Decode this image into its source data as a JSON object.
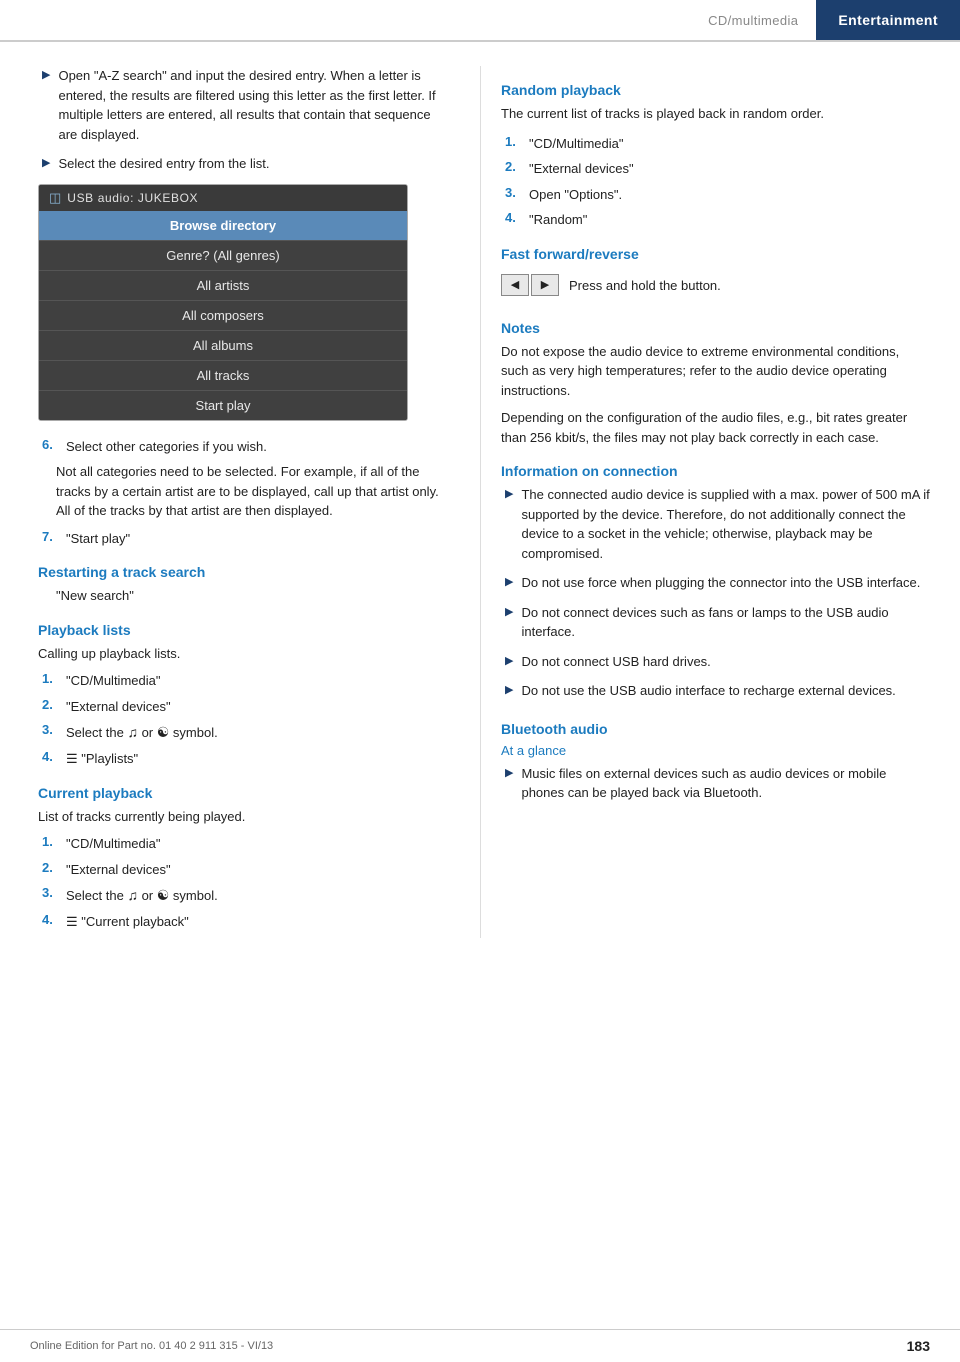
{
  "header": {
    "cd_label": "CD/multimedia",
    "entertainment_label": "Entertainment"
  },
  "left_col": {
    "bullet1": "Open \"A-Z search\" and input the desired entry. When a letter is entered, the results are filtered using this letter as the first letter. If multiple letters are entered, all results that contain that sequence are displayed.",
    "bullet2": "Select the desired entry from the list.",
    "usb_box": {
      "header_icon": "⊞",
      "header_title": "USB audio: JUKEBOX",
      "menu_items": [
        {
          "label": "Browse directory",
          "highlighted": true
        },
        {
          "label": "Genre? (All genres)",
          "highlighted": false
        },
        {
          "label": "All artists",
          "highlighted": false
        },
        {
          "label": "All composers",
          "highlighted": false
        },
        {
          "label": "All albums",
          "highlighted": false
        },
        {
          "label": "All tracks",
          "highlighted": false
        },
        {
          "label": "Start play",
          "highlighted": false
        }
      ]
    },
    "step6_label": "6.",
    "step6_text": "Select other categories if you wish.",
    "step6_detail": "Not all categories need to be selected. For example, if all of the tracks by a certain artist are to be displayed, call up that artist only. All of the tracks by that artist are then displayed.",
    "step7_label": "7.",
    "step7_text": "\"Start play\"",
    "restarting_heading": "Restarting a track search",
    "restarting_text": "\"New search\"",
    "playback_heading": "Playback lists",
    "playback_intro": "Calling up playback lists.",
    "playback_steps": [
      {
        "num": "1.",
        "text": "\"CD/Multimedia\""
      },
      {
        "num": "2.",
        "text": "\"External devices\""
      },
      {
        "num": "3.",
        "text": "Select the"
      },
      {
        "num": "4.",
        "text": "\"Playlists\""
      }
    ],
    "playback_step3_or": "or",
    "playback_step3_symbol": "symbol.",
    "current_heading": "Current playback",
    "current_intro": "List of tracks currently being played.",
    "current_steps": [
      {
        "num": "1.",
        "text": "\"CD/Multimedia\""
      },
      {
        "num": "2.",
        "text": "\"External devices\""
      },
      {
        "num": "3.",
        "text": "Select the"
      },
      {
        "num": "4.",
        "text": "\"Current playback\""
      }
    ],
    "current_step3_or": "or",
    "current_step3_symbol": "symbol.",
    "current_step4_icon": "🎵"
  },
  "right_col": {
    "random_heading": "Random playback",
    "random_intro": "The current list of tracks is played back in random order.",
    "random_steps": [
      {
        "num": "1.",
        "text": "\"CD/Multimedia\""
      },
      {
        "num": "2.",
        "text": "\"External devices\""
      },
      {
        "num": "3.",
        "text": "Open \"Options\"."
      },
      {
        "num": "4.",
        "text": "\"Random\""
      }
    ],
    "ff_heading": "Fast forward/reverse",
    "ff_text": "Press and hold the button.",
    "notes_heading": "Notes",
    "notes_text1": "Do not expose the audio device to extreme environmental conditions, such as very high temperatures; refer to the audio device operating instructions.",
    "notes_text2": "Depending on the configuration of the audio files, e.g., bit rates greater than 256 kbit/s, the files may not play back correctly in each case.",
    "info_conn_heading": "Information on connection",
    "info_bullets": [
      "The connected audio device is supplied with a max. power of 500 mA if supported by the device. Therefore, do not additionally connect the device to a socket in the vehicle; otherwise, playback may be compromised.",
      "Do not use force when plugging the connector into the USB interface.",
      "Do not connect devices such as fans or lamps to the USB audio interface.",
      "Do not connect USB hard drives.",
      "Do not use the USB audio interface to recharge external devices."
    ],
    "bluetooth_heading": "Bluetooth audio",
    "at_glance_heading": "At a glance",
    "at_glance_bullet": "Music files on external devices such as audio devices or mobile phones can be played back via Bluetooth."
  },
  "footer": {
    "edition_text": "Online Edition for Part no. 01 40 2 911 315 - VI/13",
    "page_number": "183"
  }
}
